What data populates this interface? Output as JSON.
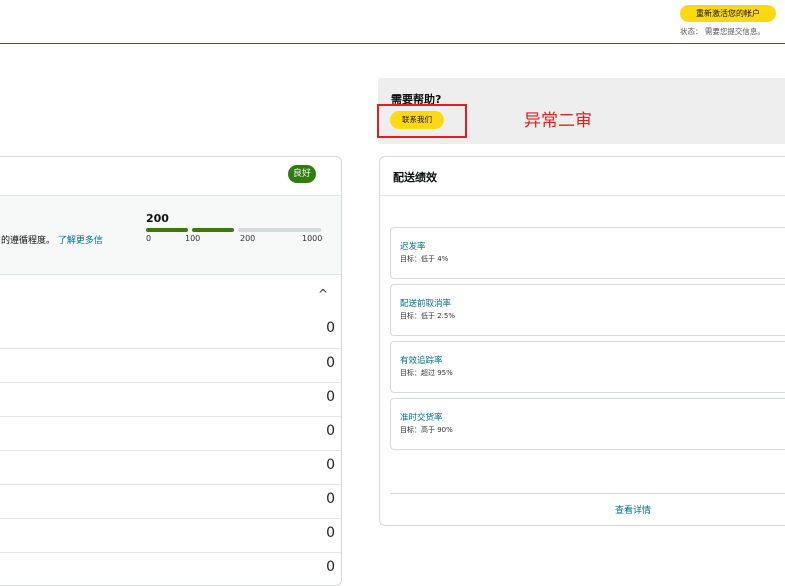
{
  "header": {
    "reactivate_label": "重新激活您的帐户",
    "status_text": "状态： 需要您提交信息。"
  },
  "health": {
    "badge": "良好",
    "description": "的遵循程度。",
    "learn_more": "了解更多信",
    "score": "200",
    "score_value": 200,
    "ticks": [
      "0",
      "100",
      "200",
      "1000"
    ],
    "rows": [
      "0",
      "0",
      "0",
      "0",
      "0",
      "0",
      "0",
      "0"
    ]
  },
  "help": {
    "title": "需要帮助?",
    "contact_label": "联系我们",
    "annotation": "异常二审"
  },
  "performance": {
    "title": "配送绩效",
    "metrics": [
      {
        "name": "迟发率",
        "target": "目标：低于 4%"
      },
      {
        "name": "配送前取消率",
        "target": "目标：低于 2.5%"
      },
      {
        "name": "有效追踪率",
        "target": "目标：超过 95%"
      },
      {
        "name": "准时交货率",
        "target": "目标：高于 90%"
      }
    ],
    "details_link": "查看详情"
  },
  "colors": {
    "accent_yellow": "#ffd814",
    "good_green": "#2f7d0e",
    "link_teal": "#007185",
    "annotation_red": "#e02020"
  }
}
